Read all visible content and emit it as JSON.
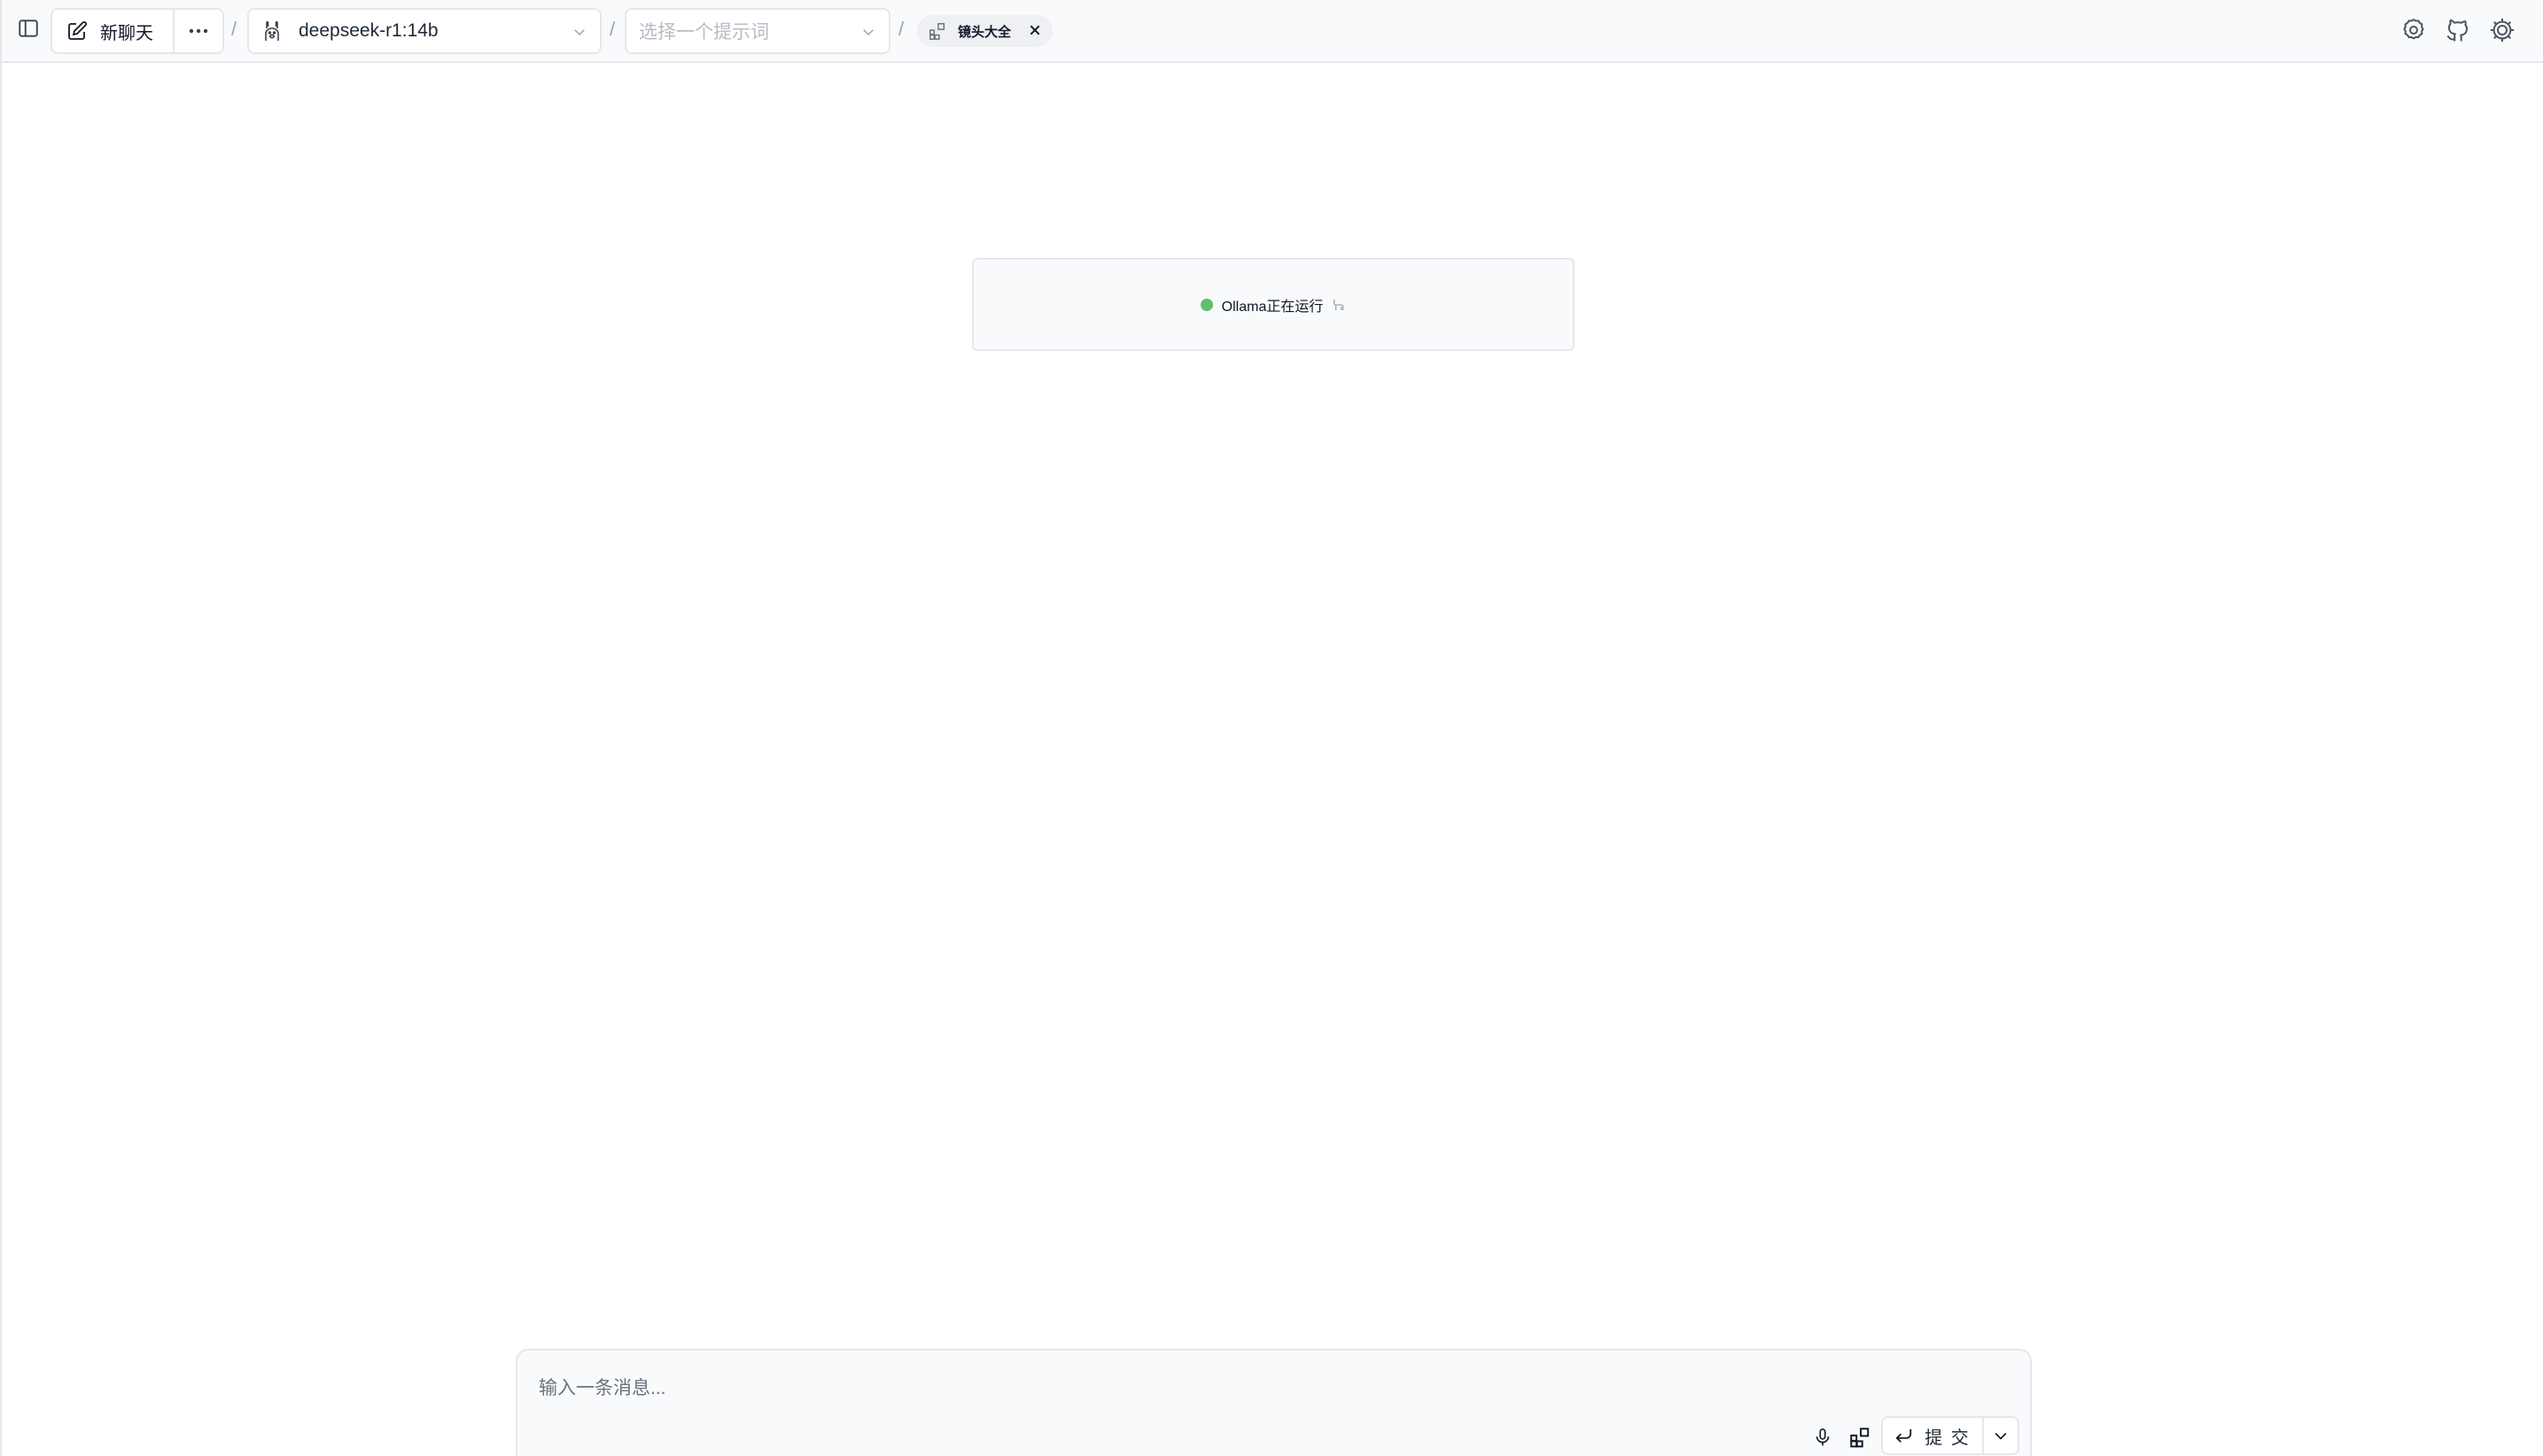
{
  "header": {
    "sidebar_toggle_icon": "sidebar-panel-icon",
    "new_chat_label": "新聊天",
    "new_chat_icon": "edit-icon",
    "more_icon": "ellipsis-icon",
    "separator": "/",
    "model": {
      "selected": "deepseek-r1:14b",
      "icon": "llama-icon"
    },
    "prompt": {
      "placeholder": "选择一个提示词"
    },
    "tag": {
      "label": "镜头大全",
      "icon": "widget-icon"
    },
    "right_icons": [
      "settings-icon",
      "github-icon",
      "theme-icon"
    ]
  },
  "status": {
    "text": "Ollama正在运行",
    "dot_color": "#5fbf6b"
  },
  "composer": {
    "placeholder": "输入一条消息...",
    "submit_label": "提 交",
    "icons": [
      "microphone-icon",
      "widget-icon",
      "enter-icon",
      "chevron-down-icon"
    ]
  }
}
